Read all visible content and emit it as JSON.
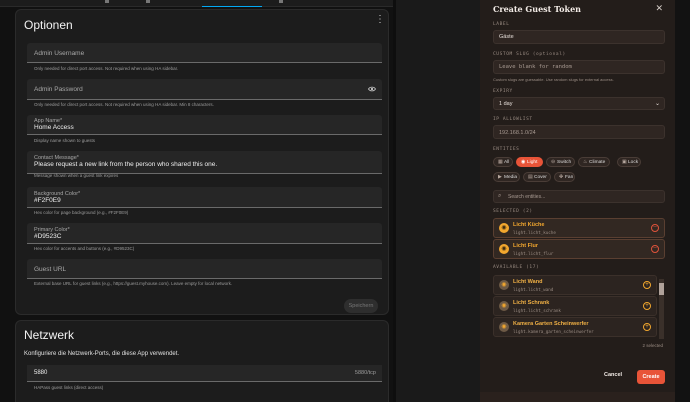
{
  "top_tabs": [
    "Info",
    "Guest Tokens",
    "",
    "Logs"
  ],
  "optionen": {
    "title": "Optionen",
    "fields": [
      {
        "label": "Admin Username",
        "value": "",
        "helper": "Only needed for direct port access. Not required when using HA sidebar."
      },
      {
        "label": "Admin Password",
        "value": "",
        "helper": "Only needed for direct port access. Not required when using HA sidebar. Min 8 characters."
      },
      {
        "label": "App Name*",
        "value": "Home Access",
        "helper": "Display name shown to guests"
      },
      {
        "label": "Contact Message*",
        "value": "Please request a new link from the person who shared this one.",
        "helper": "Message shown when a guest link expires"
      },
      {
        "label": "Background Color*",
        "value": "#F2F0E9",
        "helper": "Hex color for page background (e.g., #F2F0E9)"
      },
      {
        "label": "Primary Color*",
        "value": "#D9523C",
        "helper": "Hex color for accents and buttons (e.g., #D9523C)"
      },
      {
        "label": "Guest URL",
        "value": "",
        "helper": "External base URL for guest links (e.g., https://guest.myhouse.com). Leave empty for local network."
      }
    ],
    "save_label": "Speichern"
  },
  "netzwerk": {
    "title": "Netzwerk",
    "description": "Konfiguriere die Netzwerk-Ports, die diese App verwendet.",
    "port_value": "5880",
    "port_suffix": "5880/tcp",
    "port_helper": "HAPass guest links (direct access)"
  },
  "drawer": {
    "title": "Create Guest Token",
    "label_heading": "LABEL",
    "label_value": "Gäste",
    "slug_heading": "CUSTOM SLUG",
    "slug_optional": "(optional)",
    "slug_placeholder": "Leave blank for random",
    "slug_note": "Custom slugs are guessable. Use random slugs for external access.",
    "expiry_heading": "EXPIRY",
    "expiry_value": "1 day",
    "ip_heading": "IP ALLOWLIST",
    "ip_value": "192.168.1.0/24",
    "entities_heading": "ENTITIES",
    "chips": [
      {
        "label": "All",
        "icon": "grid-icon",
        "active": false
      },
      {
        "label": "Light",
        "icon": "bulb-icon",
        "active": true
      },
      {
        "label": "Switch",
        "icon": "toggle-icon",
        "active": false
      },
      {
        "label": "Climate",
        "icon": "thermometer-icon",
        "active": false
      },
      {
        "label": "Lock",
        "icon": "lock-icon",
        "active": false
      },
      {
        "label": "Media",
        "icon": "media-icon",
        "active": false
      },
      {
        "label": "Cover",
        "icon": "cover-icon",
        "active": false
      },
      {
        "label": "Fan",
        "icon": "fan-icon",
        "active": false
      }
    ],
    "search_placeholder": "Search entities...",
    "selected_heading": "SELECTED (2)",
    "selected": [
      {
        "name": "Licht Küche",
        "id": "light.licht_kuche"
      },
      {
        "name": "Licht Flur",
        "id": "light.licht_flur"
      }
    ],
    "available_heading": "AVAILABLE (17)",
    "available": [
      {
        "name": "Licht Wand",
        "id": "light.licht_wand"
      },
      {
        "name": "Licht Schrank",
        "id": "light.licht_schrank"
      },
      {
        "name": "Kamera Garten Scheinwerfer",
        "id": "light.kamera_garten_scheinwerfer"
      }
    ],
    "selected_count": "2 selected",
    "cancel_label": "Cancel",
    "create_label": "Create"
  },
  "colors": {
    "accent": "#E85438",
    "entity": "#F2A72E",
    "drawer_bg": "#231D1A"
  }
}
